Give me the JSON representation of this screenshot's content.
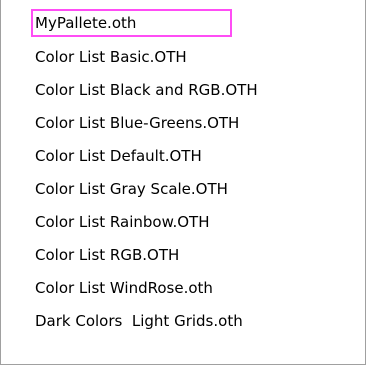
{
  "file_list": {
    "items": [
      {
        "label": "MyPallete.oth",
        "selected": true
      },
      {
        "label": "Color List Basic.OTH",
        "selected": false
      },
      {
        "label": "Color List Black and RGB.OTH",
        "selected": false
      },
      {
        "label": "Color List Blue-Greens.OTH",
        "selected": false
      },
      {
        "label": "Color List Default.OTH",
        "selected": false
      },
      {
        "label": "Color List Gray Scale.OTH",
        "selected": false
      },
      {
        "label": "Color List Rainbow.OTH",
        "selected": false
      },
      {
        "label": "Color List RGB.OTH",
        "selected": false
      },
      {
        "label": "Color List WindRose.oth",
        "selected": false
      },
      {
        "label": "Dark Colors  Light Grids.oth",
        "selected": false
      }
    ],
    "highlight_color": "#ff4df5"
  }
}
